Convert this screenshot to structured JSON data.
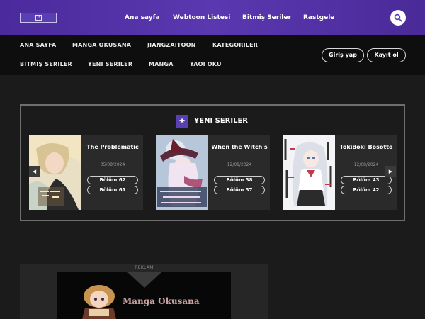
{
  "header": {
    "nav": [
      {
        "label": "Ana sayfa"
      },
      {
        "label": "Webtoon Listesi"
      },
      {
        "label": "Bitmiş Seriler"
      },
      {
        "label": "Rastgele"
      }
    ]
  },
  "subnav": {
    "row1": [
      {
        "label": "ANA SAYFA"
      },
      {
        "label": "MANGA OKUSANA"
      },
      {
        "label": "JIANGZAITOON"
      },
      {
        "label": "KATEGORILER"
      }
    ],
    "row2": [
      {
        "label": "BITMIŞ SERILER"
      },
      {
        "label": "YENI SERILER"
      },
      {
        "label": "MANGA"
      },
      {
        "label": "YAOI OKU"
      }
    ],
    "login_label": "Giriş yap",
    "register_label": "Kayıt ol"
  },
  "new_series": {
    "title": "YENI SERILER",
    "cards": [
      {
        "title": "The Problematic",
        "date": "05/08/2024",
        "chapters": [
          "Bölüm 62",
          "Bölüm 61"
        ]
      },
      {
        "title": "When the Witch's",
        "date": "12/08/2024",
        "chapters": [
          "Bölüm 38",
          "Bölüm 37"
        ]
      },
      {
        "title": "Tokidoki Bosotto",
        "date": "12/08/2024",
        "chapters": [
          "Bölüm 43",
          "Bölüm 42"
        ]
      }
    ]
  },
  "ad": {
    "label": "REKLAM",
    "brand": "Manga Okusana"
  },
  "colors": {
    "header_purple": "#4b2a9c",
    "accent": "#5a3fb3",
    "background": "#1b1b1b",
    "subnav_bg": "#0e0e0e"
  },
  "icons": [
    "logo-icon",
    "search-icon",
    "star-icon",
    "chevron-left-icon",
    "chevron-right-icon"
  ]
}
